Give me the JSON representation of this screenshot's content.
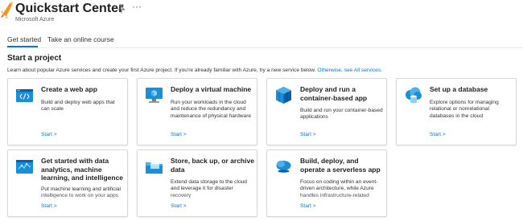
{
  "header": {
    "title": "Quickstart Center",
    "subtitle": "Microsoft Azure",
    "more": "···"
  },
  "tabs": [
    {
      "label": "Get started",
      "selected": true
    },
    {
      "label": "Take an online course",
      "selected": false
    }
  ],
  "section": {
    "title": "Start a project",
    "description": "Learn about popular Azure services and create your first Azure project. If you're already familiar with Azure, try a new service below.",
    "link": "Otherwise, see All services."
  },
  "cards": [
    {
      "title": "Create a web app",
      "description": "Build and deploy web apps that can scale",
      "start": "Start >"
    },
    {
      "title": "Deploy a virtual machine",
      "description": "Run your workloads in the cloud and reduce the redundancy and maintenance of physical hardware",
      "start": "Start >"
    },
    {
      "title": "Deploy and run a container-based app",
      "description": "Build and run your container-based applications",
      "start": "Start >"
    },
    {
      "title": "Set up a database",
      "description": "Explore options for managing relational or nonrelational databases in the cloud",
      "start": "Start >"
    },
    {
      "title": "Get started with data analytics, machine learning, and intelligence",
      "description": "Put machine learning and artificial intelligence to work on your apps",
      "start": "Start >"
    },
    {
      "title": "Store, back up, or archive data",
      "description": "Extend data storage to the cloud and leverage it for disaster recovery",
      "start": "Start >"
    },
    {
      "title": "Build, deploy, and operate a serverless app",
      "description": "Focus on coding within an event-driven architecture, while Azure handles infrastructure-related",
      "start": "Start >"
    }
  ],
  "colors": {
    "accent": "#0078d4",
    "rocket": "#f7941d"
  }
}
